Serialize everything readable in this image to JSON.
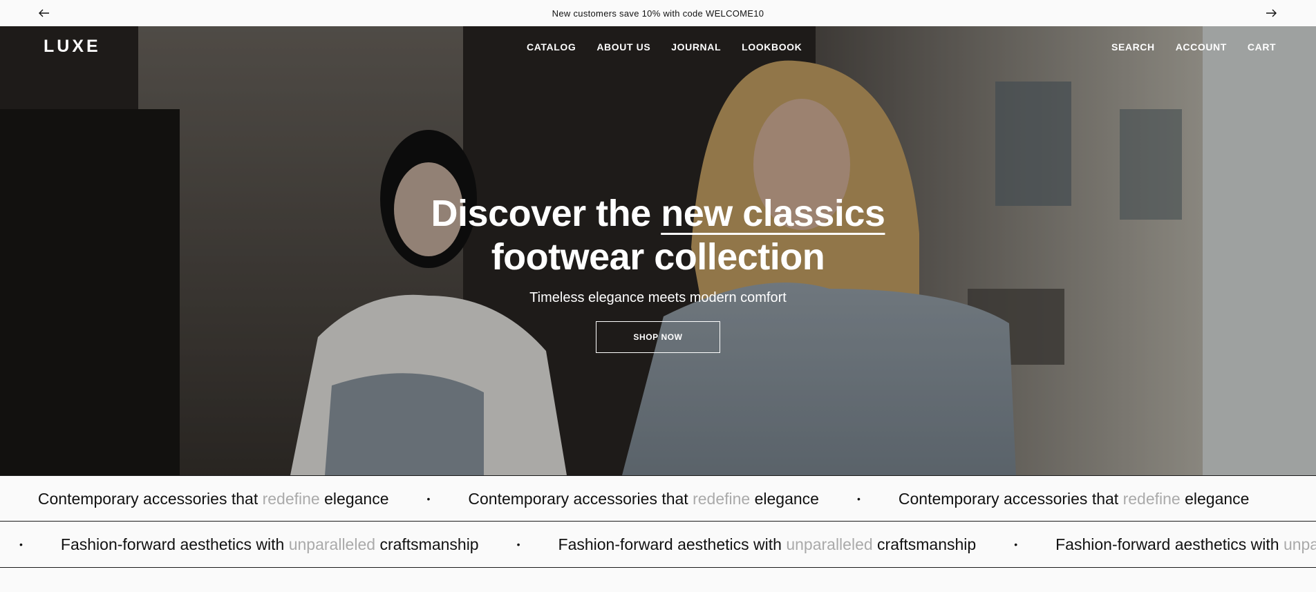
{
  "announcement": {
    "message": "New customers save 10% with code WELCOME10"
  },
  "header": {
    "logo": "LUXE",
    "nav_center": [
      "CATALOG",
      "ABOUT US",
      "JOURNAL",
      "LOOKBOOK"
    ],
    "nav_right": [
      "SEARCH",
      "ACCOUNT",
      "CART"
    ]
  },
  "hero": {
    "title_prefix": "Discover the",
    "title_highlight": "new classics",
    "title_line2": "footwear collection",
    "subtitle": "Timeless elegance meets modern comfort",
    "cta_label": "SHOP NOW"
  },
  "marquee_1": {
    "before": "Contemporary accessories that",
    "highlight": "redefine",
    "after": "elegance"
  },
  "marquee_2": {
    "before": "Fashion-forward aesthetics with",
    "highlight": "unparalleled",
    "after": "craftsmanship"
  },
  "colors": {
    "text": "#111111",
    "muted": "#aaaaaa",
    "background": "#fafafa"
  }
}
